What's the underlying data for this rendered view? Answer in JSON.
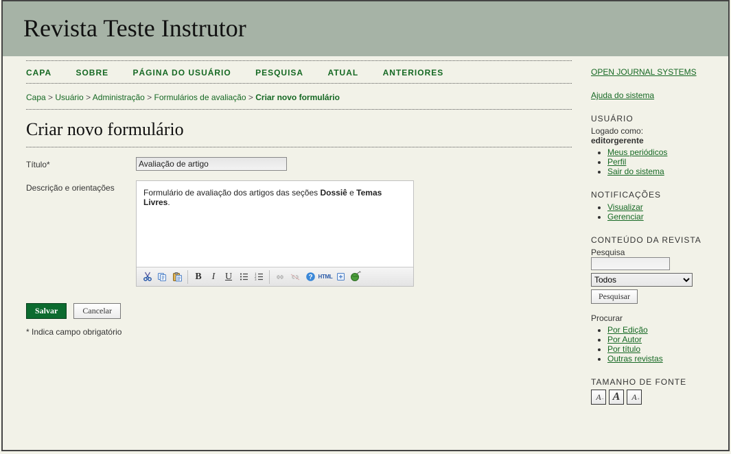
{
  "header": {
    "journal_title": "Revista Teste Instrutor"
  },
  "nav": {
    "items": [
      "CAPA",
      "SOBRE",
      "PÁGINA DO USUÁRIO",
      "PESQUISA",
      "ATUAL",
      "ANTERIORES"
    ]
  },
  "breadcrumb": {
    "items": [
      {
        "label": "Capa",
        "current": false
      },
      {
        "label": "Usuário",
        "current": false
      },
      {
        "label": "Administração",
        "current": false
      },
      {
        "label": "Formulários de avaliação",
        "current": false
      },
      {
        "label": "Criar novo formulário",
        "current": true
      }
    ],
    "sep": " > "
  },
  "page": {
    "title": "Criar novo formulário",
    "label_title": "Título*",
    "title_value": "Avaliação de artigo",
    "label_desc": "Descrição e orientações",
    "desc_prefix": "Formulário de avaliação dos artigos das seções ",
    "desc_bold1": "Dossiê",
    "desc_mid": " e ",
    "desc_bold2": "Temas Livres",
    "desc_suffix": ".",
    "btn_save": "Salvar",
    "btn_cancel": "Cancelar",
    "required_note": "* Indica campo obrigatório"
  },
  "toolbar": {
    "cut": "cut-icon",
    "copy": "copy-icon",
    "paste": "paste-icon",
    "bold": "B",
    "italic": "I",
    "underline": "U",
    "ul": "ul-icon",
    "ol": "ol-icon",
    "link": "link-icon",
    "unlink": "unlink-icon",
    "help": "?",
    "html": "HTML",
    "clean": "clean-icon",
    "world": "world-icon"
  },
  "sidebar": {
    "ojs": "OPEN JOURNAL SYSTEMS",
    "help": "Ajuda do sistema",
    "user_title": "USUÁRIO",
    "logged_as": "Logado como:",
    "username": "editorgerente",
    "user_links": [
      "Meus periódicos",
      "Perfil",
      "Sair do sistema"
    ],
    "notif_title": "NOTIFICAÇÕES",
    "notif_links": [
      "Visualizar",
      "Gerenciar"
    ],
    "content_title": "CONTEÚDO DA REVISTA",
    "search_label": "Pesquisa",
    "search_value": "",
    "search_scope": "Todos",
    "search_btn": "Pesquisar",
    "browse_label": "Procurar",
    "browse_links": [
      "Por Edição",
      "Por Autor",
      "Por título",
      "Outras revistas"
    ],
    "font_title": "TAMANHO DE FONTE"
  }
}
